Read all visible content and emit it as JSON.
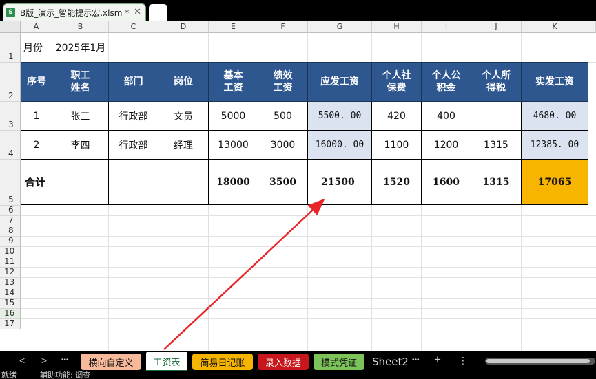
{
  "window": {
    "file_tab_title": "B版_演示_智能提示宏.xlsm *",
    "close_glyph": "✕",
    "file_icon_letter": "S"
  },
  "columns": [
    "A",
    "B",
    "C",
    "D",
    "E",
    "F",
    "G",
    "H",
    "I",
    "J",
    "K"
  ],
  "rows": [
    "1",
    "2",
    "3",
    "4",
    "5",
    "6",
    "7",
    "8",
    "9",
    "10",
    "11",
    "12",
    "13",
    "14",
    "15",
    "16",
    "17"
  ],
  "cells": {
    "a1": "月份",
    "b1": "2025年1月",
    "headers": [
      "序号",
      "职工\n姓名",
      "部门",
      "岗位",
      "基本\n工资",
      "绩效\n工资",
      "应发工资",
      "个人社\n保费",
      "个人公\n积金",
      "个人所\n得税",
      "实发工资"
    ],
    "row3": [
      "1",
      "张三",
      "行政部",
      "文员",
      "5000",
      "500",
      "5500. 00",
      "420",
      "400",
      "",
      "4680. 00"
    ],
    "row4": [
      "2",
      "李四",
      "行政部",
      "经理",
      "13000",
      "3000",
      "16000. 00",
      "1100",
      "1200",
      "1315",
      "12385. 00"
    ],
    "row5": [
      "合计",
      "",
      "",
      "",
      "18000",
      "3500",
      "21500",
      "1520",
      "1600",
      "1315",
      "17065"
    ]
  },
  "colors": {
    "header_fill": "#2e5790",
    "calc_fill": "#dae3ef",
    "total_fill": "#f8b500",
    "arrow": "#e8262a"
  },
  "sheet_tabs": {
    "prev": "<",
    "next": ">",
    "more": "•••",
    "tabs": [
      {
        "label": "横向自定义",
        "color": "#f6b99a"
      },
      {
        "label": "工资表",
        "color": "#ffffff",
        "active": true
      },
      {
        "label": "简易日记账",
        "color": "#f6b400"
      },
      {
        "label": "录入数据",
        "color": "#c8161d"
      },
      {
        "label": "模式凭证",
        "color": "#7cc35a"
      },
      {
        "label": "Sheet2",
        "color": ""
      }
    ],
    "more2": "•••",
    "add": "+",
    "menu": "⋮"
  },
  "status": {
    "ready": "就绪",
    "accessibility": "辅助功能: 调查"
  }
}
